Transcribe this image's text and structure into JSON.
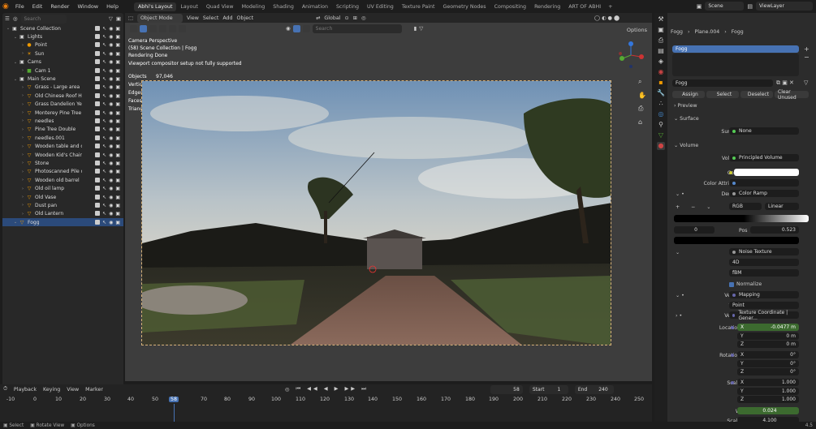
{
  "menu": [
    "File",
    "Edit",
    "Render",
    "Window",
    "Help"
  ],
  "workspaces": [
    "Abhi's Layout",
    "Layout",
    "Quad View",
    "Modeling",
    "Shading",
    "Animation",
    "Scripting",
    "UV Editing",
    "Texture Paint",
    "Geometry Nodes",
    "Compositing",
    "Rendering",
    "ART OF ABHI"
  ],
  "scene_label": "Scene",
  "viewlayer_label": "ViewLayer",
  "outliner": {
    "search_placeholder": "Search",
    "rows": [
      {
        "label": "Scene Collection",
        "indent": 0,
        "icon": "▣"
      },
      {
        "label": "Lights",
        "indent": 1,
        "icon": "▣"
      },
      {
        "label": "Point",
        "indent": 2,
        "icon": "●"
      },
      {
        "label": "Sun",
        "indent": 2,
        "icon": "☀"
      },
      {
        "label": "Cams",
        "indent": 1,
        "icon": "▣"
      },
      {
        "label": "Cam 1",
        "indent": 2,
        "icon": "■"
      },
      {
        "label": "Main Scene",
        "indent": 1,
        "icon": "▣"
      },
      {
        "label": "Grass - Large area",
        "indent": 2,
        "icon": "▽"
      },
      {
        "label": "Old Chinese Roof Hou",
        "indent": 2,
        "icon": "▽"
      },
      {
        "label": "Grass Dandelion Yello",
        "indent": 2,
        "icon": "▽"
      },
      {
        "label": "Monterey Pine Tree",
        "indent": 2,
        "icon": "▽"
      },
      {
        "label": "needles",
        "indent": 2,
        "icon": "▽"
      },
      {
        "label": "Pine Tree Double",
        "indent": 2,
        "icon": "▽"
      },
      {
        "label": "needles.001",
        "indent": 2,
        "icon": "▽"
      },
      {
        "label": "Wooden table and ch",
        "indent": 2,
        "icon": "▽"
      },
      {
        "label": "Wooden Kid's Chair",
        "indent": 2,
        "icon": "▽"
      },
      {
        "label": "Stone",
        "indent": 2,
        "icon": "▽"
      },
      {
        "label": "Photoscanned Pile of",
        "indent": 2,
        "icon": "▽"
      },
      {
        "label": "Wooden old barrel",
        "indent": 2,
        "icon": "▽"
      },
      {
        "label": "Old oil lamp",
        "indent": 2,
        "icon": "▽"
      },
      {
        "label": "Old Vase",
        "indent": 2,
        "icon": "▽"
      },
      {
        "label": "Dust pan",
        "indent": 2,
        "icon": "▽"
      },
      {
        "label": "Old Lantern",
        "indent": 2,
        "icon": "▽"
      },
      {
        "label": "Fogg",
        "indent": 1,
        "icon": "▽",
        "selected": true
      }
    ]
  },
  "viewport": {
    "mode": "Object Mode",
    "menus": [
      "View",
      "Select",
      "Add",
      "Object"
    ],
    "transform": "Global",
    "search_placeholder": "Search",
    "options": "Options",
    "overlay": [
      "Camera Perspective",
      "(58) Scene Collection | Fogg",
      "Rendering Done",
      "Viewport compositor setup not fully supported"
    ],
    "stats": [
      [
        "Objects",
        "97,046"
      ],
      [
        "Vertices",
        "2,220,874"
      ],
      [
        "Edges",
        "3,537,961"
      ],
      [
        "Faces",
        "1,838,654"
      ],
      [
        "Triangles",
        "3,674,630"
      ]
    ]
  },
  "timeline": {
    "menus": [
      "Playback",
      "Keying",
      "View",
      "Marker"
    ],
    "current_frame": "58",
    "start_label": "Start",
    "start": "1",
    "end_label": "End",
    "end": "240",
    "ticks": [
      "-10",
      "0",
      "10",
      "20",
      "30",
      "40",
      "50",
      "58",
      "70",
      "80",
      "90",
      "100",
      "110",
      "120",
      "130",
      "140",
      "150",
      "160",
      "170",
      "180",
      "190",
      "200",
      "210",
      "220",
      "230",
      "240",
      "250"
    ]
  },
  "properties": {
    "breadcrumb": [
      "Fogg",
      "Plane.004",
      "Fogg"
    ],
    "material_slot": "Fogg",
    "material_name": "Fogg",
    "actions": [
      "Assign",
      "Select",
      "Deselect",
      "Clear Unused"
    ],
    "preview": "Preview",
    "surface_panel": "Surface",
    "surface_label": "Surface",
    "surface_value": "None",
    "volume_panel": "Volume",
    "volume_label": "Volume",
    "volume_value": "Principled Volume",
    "color_label": "Color",
    "color_attr_label": "Color Attribute",
    "density_label": "Density",
    "density_value": "Color Ramp",
    "ramp_mode": "RGB",
    "ramp_interp": "Linear",
    "ramp_index": "0",
    "pos_label": "Pos",
    "pos_value": "0.523",
    "fac_label": "Fac",
    "fac_value": "Noise Texture",
    "noise_dim": "4D",
    "noise_type": "fBM",
    "normalize": "Normalize",
    "vector_label": "Vector",
    "vector_value": "Mapping",
    "type_label": "Type",
    "type_value": "Point",
    "vector2_label": "Vector",
    "vector2_value": "Texture Coordinate | Gener...",
    "location_label": "Location",
    "location": [
      [
        "X",
        "-0.0477 m"
      ],
      [
        "Y",
        "0 m"
      ],
      [
        "Z",
        "0 m"
      ]
    ],
    "rotation_label": "Rotation",
    "rotation": [
      [
        "X",
        "0°"
      ],
      [
        "Y",
        "0°"
      ],
      [
        "Z",
        "0°"
      ]
    ],
    "scale_label": "Scale",
    "scale": [
      [
        "X",
        "1.000"
      ],
      [
        "Y",
        "1.000"
      ],
      [
        "Z",
        "1.000"
      ]
    ],
    "w_label": "W",
    "w_value": "0.024",
    "scale2_label": "Scale",
    "scale2_value": "4.100",
    "version": "4.5"
  },
  "status": [
    "Select",
    "Rotate View",
    "Options"
  ]
}
